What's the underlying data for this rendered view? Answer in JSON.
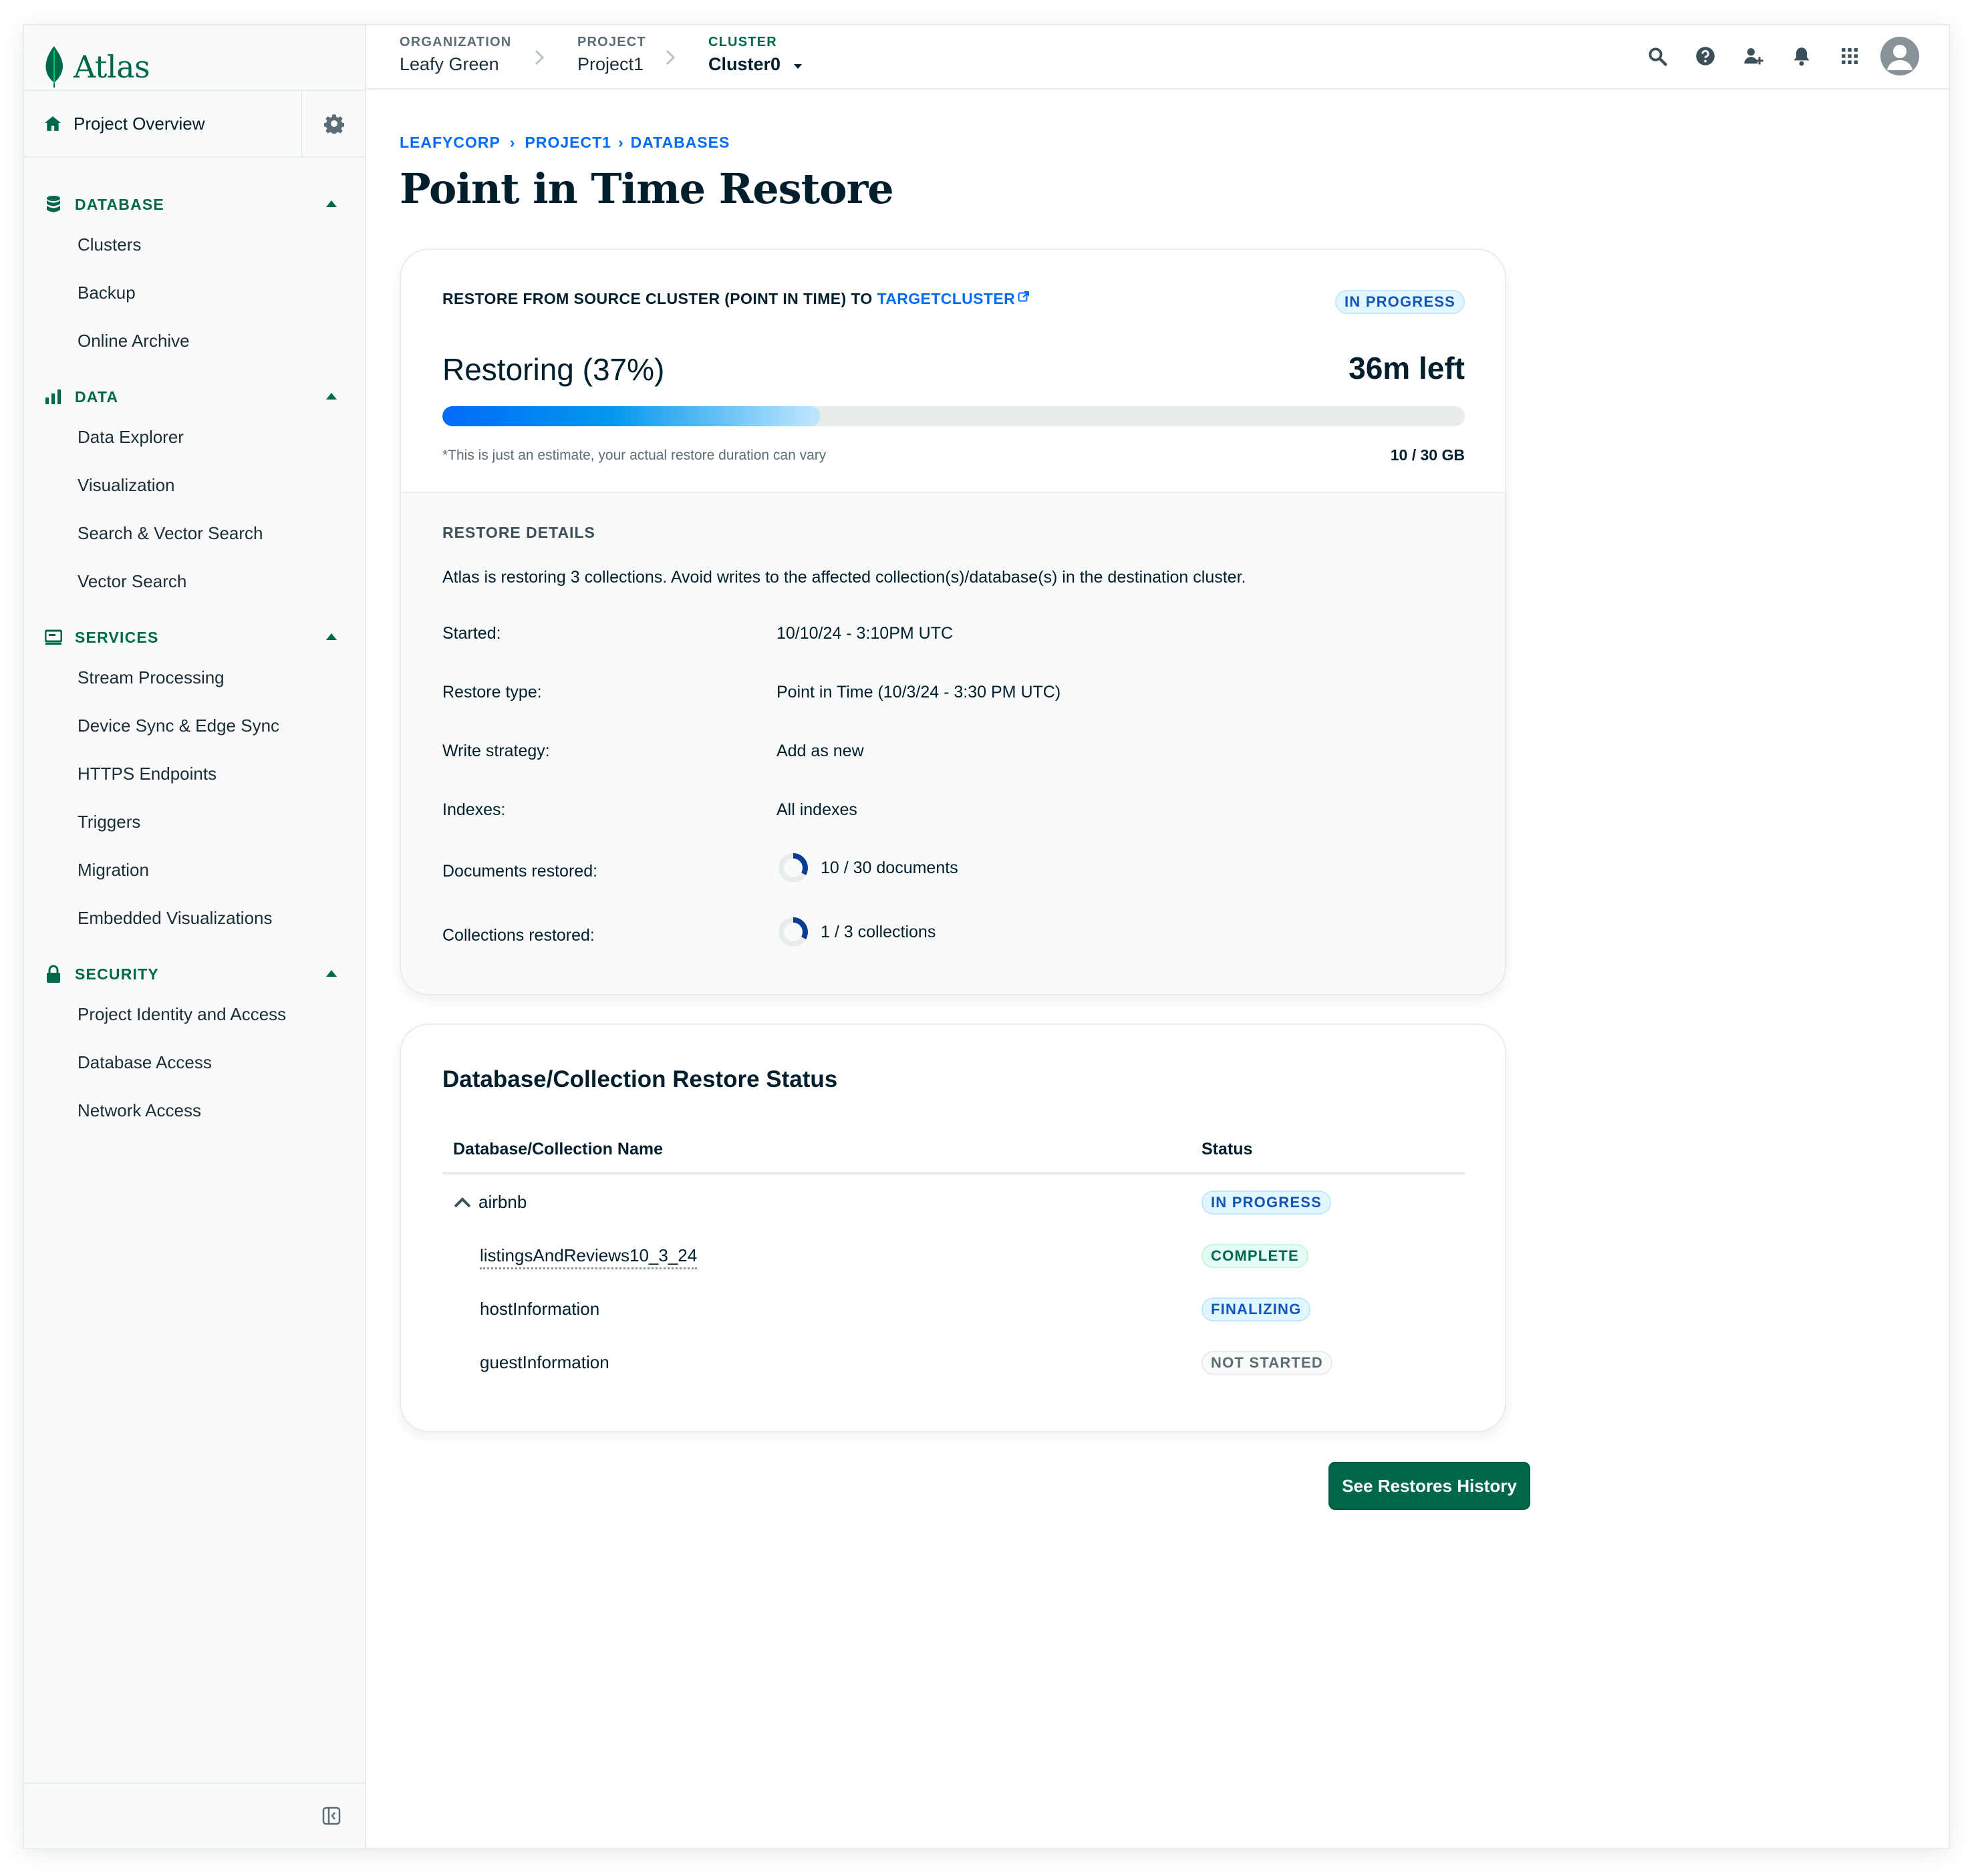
{
  "app": {
    "name": "Atlas"
  },
  "colors": {
    "brand_green": "#00684a",
    "link_blue": "#016bf8",
    "progress_gradient_start": "#016bf8",
    "progress_gradient_end": "#c3e7fe"
  },
  "sidebar": {
    "project_overview": {
      "label": "Project Overview",
      "icon": "home-icon",
      "settings_icon": "gear-icon"
    },
    "sections": [
      {
        "title": "DATABASE",
        "icon": "database-icon",
        "items": [
          "Clusters",
          "Backup",
          "Online Archive"
        ]
      },
      {
        "title": "DATA",
        "icon": "bar-chart-icon",
        "items": [
          "Data Explorer",
          "Visualization",
          "Search & Vector Search",
          "Vector Search"
        ]
      },
      {
        "title": "SERVICES",
        "icon": "services-icon",
        "items": [
          "Stream Processing",
          "Device Sync & Edge Sync",
          "HTTPS Endpoints",
          "Triggers",
          "Migration",
          "Embedded Visualizations"
        ]
      },
      {
        "title": "SECURITY",
        "icon": "lock-icon",
        "items": [
          "Project Identity and Access",
          "Database Access",
          "Network Access"
        ]
      }
    ],
    "collapse_icon": "collapse-sidebar-icon"
  },
  "topbar": {
    "organization": {
      "label": "ORGANIZATION",
      "value": "Leafy Green"
    },
    "project": {
      "label": "PROJECT",
      "value": "Project1"
    },
    "cluster": {
      "label": "CLUSTER",
      "value": "Cluster0"
    },
    "icons": [
      "search-icon",
      "help-icon",
      "invite-user-icon",
      "bell-icon",
      "apps-grid-icon",
      "user-avatar-icon"
    ]
  },
  "page": {
    "breadcrumbs": [
      "LEAFYCORP",
      "PROJECT1",
      "DATABASES"
    ],
    "title": "Point in Time Restore"
  },
  "restore": {
    "header_prefix": "RESTORE FROM SOURCE CLUSTER (POINT IN TIME) TO ",
    "target_link": "TARGETCLUSTER",
    "status": "IN PROGRESS",
    "progress_label": "Restoring (37%)",
    "progress_percent": 37,
    "time_left": "36m left",
    "estimate_note": "*This is just an estimate, your actual restore duration can vary",
    "size": "10 / 30 GB"
  },
  "details": {
    "title": "RESTORE DETAILS",
    "description": "Atlas is restoring 3 collections. Avoid writes to the affected collection(s)/database(s) in the destination cluster.",
    "rows": [
      {
        "label": "Started:",
        "value": "10/10/24 - 3:10PM UTC"
      },
      {
        "label": "Restore type:",
        "value": "Point in Time (10/3/24 - 3:30 PM UTC)"
      },
      {
        "label": "Write strategy:",
        "value": "Add as new"
      },
      {
        "label": "Indexes:",
        "value": "All indexes"
      },
      {
        "label": "Documents restored:",
        "value": "10 / 30 documents",
        "fraction": 0.333
      },
      {
        "label": "Collections restored:",
        "value": "1 / 3 collections",
        "fraction": 0.333
      }
    ]
  },
  "status_table": {
    "title": "Database/Collection Restore Status",
    "columns": [
      "Database/Collection Name",
      "Status"
    ],
    "rows": [
      {
        "name": "airbnb",
        "status": "IN PROGRESS",
        "status_color": "blue",
        "expanded": true
      },
      {
        "name": "listingsAndReviews10_3_24",
        "status": "COMPLETE",
        "status_color": "green"
      },
      {
        "name": "hostInformation",
        "status": "FINALIZING",
        "status_color": "blue"
      },
      {
        "name": "guestInformation",
        "status": "NOT STARTED",
        "status_color": "gray"
      }
    ]
  },
  "actions": {
    "see_history": "See Restores History"
  }
}
